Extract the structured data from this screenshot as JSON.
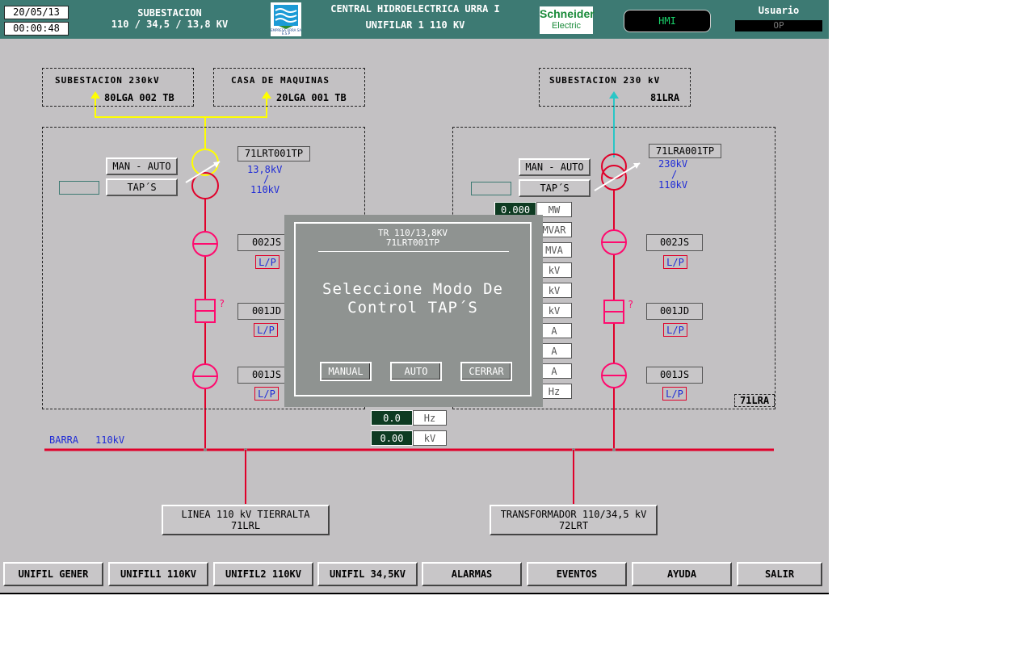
{
  "header": {
    "date": "20/05/13",
    "time": "00:00:48",
    "substation_title": "SUBESTACION",
    "substation_voltages": "110 / 34,5 / 13,8 KV",
    "plant_title": "CENTRAL HIDROELECTRICA URRA I",
    "screen_title": "UNIFILAR 1  110 KV",
    "urra_logo_text": "EMPRESA URRA SA E.S.P",
    "schneider_logo_line1": "Schneider",
    "schneider_logo_line2": "Electric",
    "hmi_label": "HMI",
    "user_label": "Usuario",
    "user_value": "OP"
  },
  "left": {
    "box1_title": "SUBESTACION 230kV",
    "box1_tag": "80LGA 002 TB",
    "box2_title": "CASA DE MAQUINAS",
    "box2_tag": "20LGA 001 TB",
    "man_auto": "MAN - AUTO",
    "taps": "TAP´S",
    "transformer_tag": "71LRT001TP",
    "ratio_high": "13,8kV",
    "ratio_sep": "/",
    "ratio_low": "110kV",
    "switch1": "002JS",
    "breaker": "001JD",
    "switch2": "001JS",
    "lp": "L/P",
    "breaker_status": "?"
  },
  "right": {
    "box_title": "SUBESTACION 230 kV",
    "box_tag": "81LRA",
    "man_auto": "MAN - AUTO",
    "taps": "TAP´S",
    "transformer_tag": "71LRA001TP",
    "ratio_high": "230kV",
    "ratio_sep": "/",
    "ratio_low": "110kV",
    "switch1": "002JS",
    "breaker": "001JD",
    "switch2": "001JS",
    "lp": "L/P",
    "breaker_status": "?",
    "bay_tag": "71LRA"
  },
  "measurements": {
    "mw_value": "0.000",
    "units": [
      "MW",
      "MVAR",
      "MVA",
      "kV",
      "kV",
      "kV",
      "A",
      "A",
      "A",
      "Hz"
    ],
    "freq_value": "0.0",
    "freq_unit": "Hz",
    "volt_value": "0.00",
    "volt_unit": "kV"
  },
  "bus": {
    "label_name": "BARRA",
    "label_voltage": "110kV"
  },
  "feeders": {
    "line_title": "LINEA 110 kV TIERRALTA",
    "line_tag": "71LRL",
    "trafo_title": "TRANSFORMADOR 110/34,5 kV",
    "trafo_tag": "72LRT"
  },
  "dialog": {
    "header_line1": "TR 110/13,8KV",
    "header_line2": "71LRT001TP",
    "message_line1": "Seleccione Modo De",
    "message_line2": "Control TAP´S",
    "manual": "MANUAL",
    "auto": "AUTO",
    "close": "CERRAR"
  },
  "nav": {
    "items": [
      "UNIFIL GENER",
      "UNIFIL1 110KV",
      "UNIFIL2 110KV",
      "UNIFIL 34,5KV",
      "ALARMAS",
      "EVENTOS",
      "AYUDA",
      "SALIR"
    ]
  },
  "colors": {
    "header_bg": "#3d7a73",
    "canvas_bg": "#c3c1c3",
    "bus_red": "#e0002a",
    "energized_yellow": "#ffff00",
    "feeder_cyan": "#29c6c6",
    "switch_magenta": "#ff0a6e",
    "label_blue": "#1f2bd6"
  }
}
